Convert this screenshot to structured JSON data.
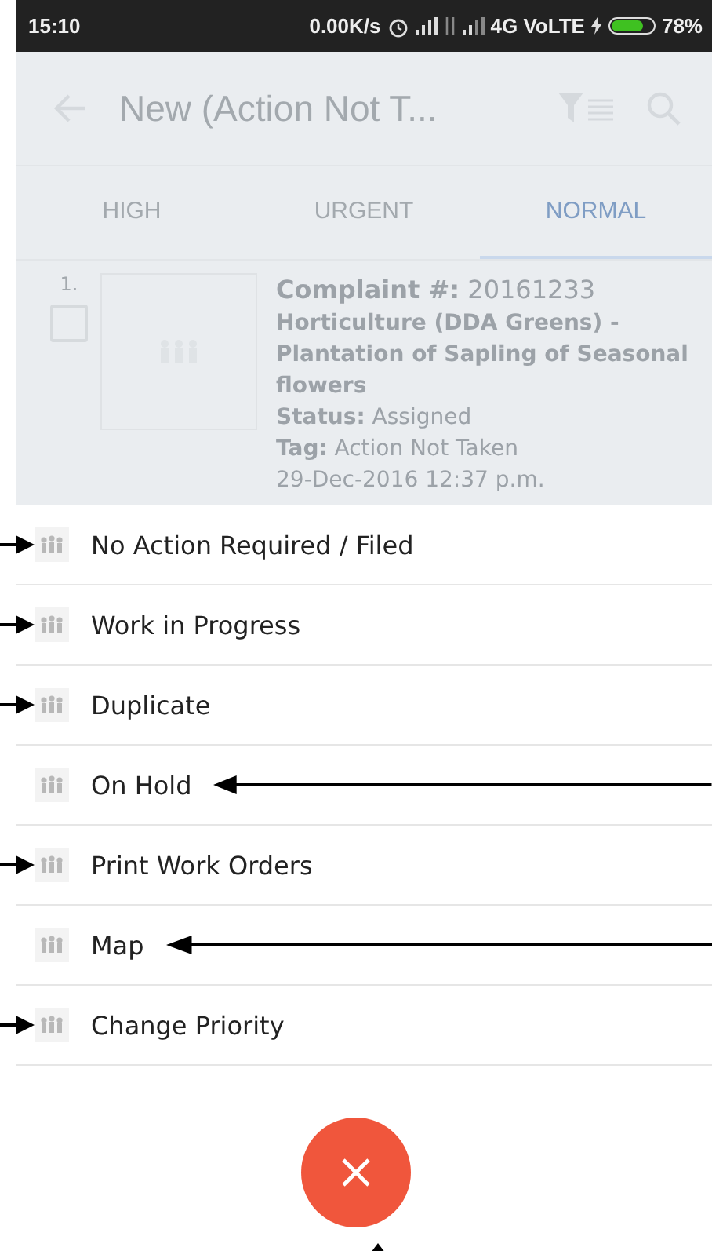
{
  "status_bar": {
    "time": "15:10",
    "speed": "0.00K/s",
    "network": "4G VoLTE",
    "battery": "78%"
  },
  "app_bar": {
    "title": "New (Action Not T..."
  },
  "tabs": [
    {
      "label": "HIGH",
      "selected": false
    },
    {
      "label": "URGENT",
      "selected": false
    },
    {
      "label": "NORMAL",
      "selected": true
    }
  ],
  "complaint": {
    "index": "1.",
    "checked": false,
    "heading": "**Complaint #:** 20161233",
    "title": "Horticulture  (DDA Greens) - Plantation of Sapling of Seasonal flowers",
    "status": "**Status:** Assigned",
    "tag": "**Tag:** Action Not Taken",
    "date": "29-Dec-2016 12:37 p.m."
  },
  "menu_items": [
    {
      "label": "No Action Required / Filed",
      "kind": "arrow_left"
    },
    {
      "label": "Work in Progress",
      "kind": "arrow_left"
    },
    {
      "label": "Duplicate",
      "kind": "arrow_left"
    },
    {
      "label": "On Hold",
      "kind": "arrow_right"
    },
    {
      "label": "Print Work Orders",
      "kind": "arrow_left"
    },
    {
      "label": "Map",
      "kind": "arrow_right"
    },
    {
      "label": "Change Priority",
      "kind": "arrow_left"
    }
  ]
}
